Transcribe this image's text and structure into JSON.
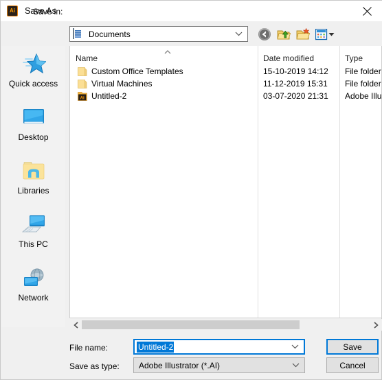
{
  "window": {
    "title": "Save As",
    "app_icon": "illustrator-ai-icon",
    "app_icon_text": "Ai",
    "close_icon": "close-icon"
  },
  "toolbar": {
    "save_in_label": "Save in:",
    "location_value": "Documents",
    "location_icon": "documents-icon",
    "buttons": [
      {
        "name": "back-button",
        "icon": "back-arrow-icon"
      },
      {
        "name": "up-one-level-button",
        "icon": "folder-up-icon"
      },
      {
        "name": "new-folder-button",
        "icon": "new-folder-icon"
      },
      {
        "name": "views-button",
        "icon": "views-grid-icon"
      }
    ]
  },
  "places": {
    "items": [
      {
        "label": "Quick access",
        "icon": "star-icon"
      },
      {
        "label": "Desktop",
        "icon": "monitor-icon"
      },
      {
        "label": "Libraries",
        "icon": "libraries-folder-icon"
      },
      {
        "label": "This PC",
        "icon": "computer-icon"
      },
      {
        "label": "Network",
        "icon": "network-globe-icon"
      }
    ]
  },
  "file_list": {
    "sort_indicator": "ascending-chevron-icon",
    "columns": [
      {
        "key": "name",
        "label": "Name"
      },
      {
        "key": "date",
        "label": "Date modified"
      },
      {
        "key": "type",
        "label": "Type"
      }
    ],
    "rows": [
      {
        "name": "Custom Office Templates",
        "date": "15-10-2019 14:12",
        "type": "File folder",
        "icon": "folder-icon"
      },
      {
        "name": "Virtual Machines",
        "date": "11-12-2019 15:31",
        "type": "File folder",
        "icon": "folder-icon"
      },
      {
        "name": "Untitled-2",
        "date": "03-07-2020 21:31",
        "type": "Adobe Illu",
        "icon": "illustrator-file-icon"
      }
    ]
  },
  "scrollbar": {
    "left_arrow": "chevron-left-icon",
    "right_arrow": "chevron-right-icon"
  },
  "form": {
    "file_name_label": "File name:",
    "file_name_value": "Untitled-2",
    "save_as_type_label": "Save as type:",
    "save_as_type_value": "Adobe Illustrator (*.AI)",
    "save_button": "Save",
    "cancel_button": "Cancel"
  },
  "colors": {
    "accent": "#0078d7",
    "dialog_bg": "#f0f0f0",
    "places_bg": "#f2f2f2",
    "list_bg": "#ffffff",
    "button_bg": "#e1e1e1",
    "folder_yellow": "#fcdf8a"
  }
}
